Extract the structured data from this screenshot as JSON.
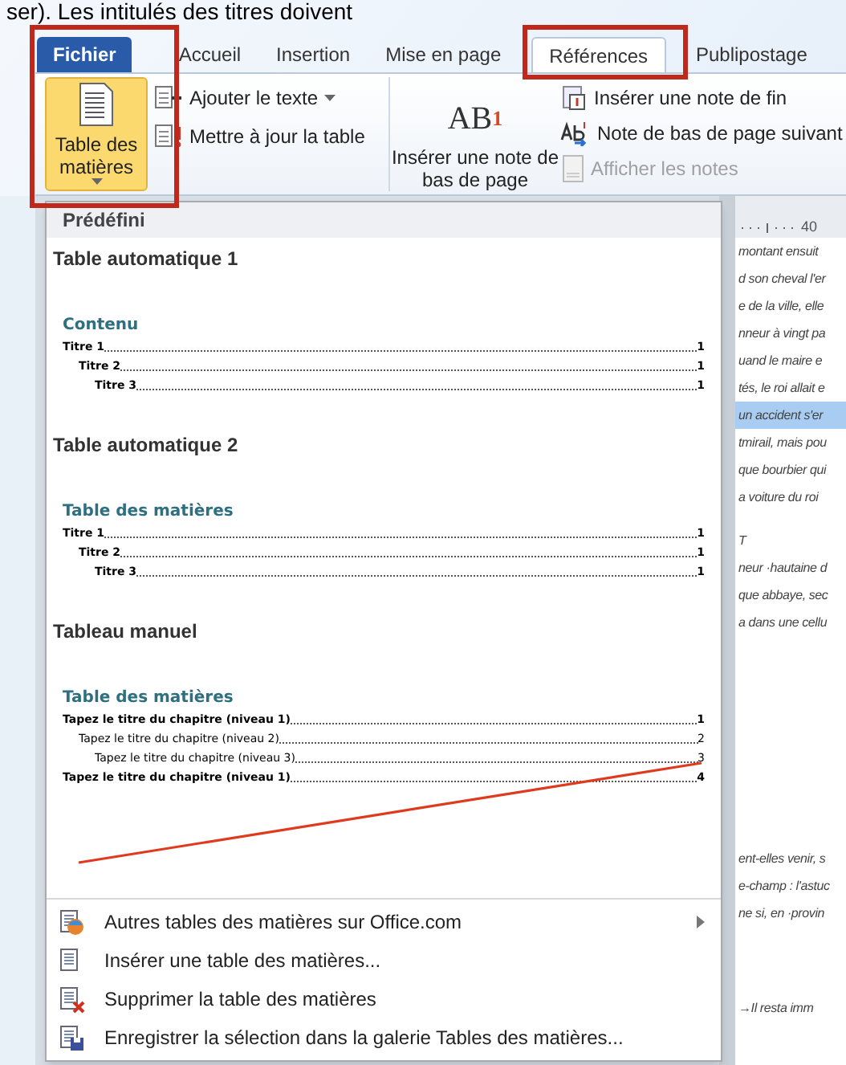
{
  "caption": "ser). Les intitulés des titres doivent",
  "tabs": [
    {
      "label": "Fichier",
      "kind": "file",
      "selected": false
    },
    {
      "label": "Accueil",
      "kind": "tab",
      "selected": false
    },
    {
      "label": "Insertion",
      "kind": "tab",
      "selected": false
    },
    {
      "label": "Mise en page",
      "kind": "tab",
      "selected": false
    },
    {
      "label": "Références",
      "kind": "tab",
      "selected": true
    },
    {
      "label": "Publipostage",
      "kind": "tab",
      "selected": false
    }
  ],
  "ribbon": {
    "toc_button": {
      "label": "Table des matières",
      "selected": true
    },
    "toc_items": [
      {
        "label": "Ajouter le texte",
        "kind": "add"
      },
      {
        "label": "Mettre à jour la table",
        "kind": "update"
      }
    ],
    "footnote_button": {
      "glyph": "AB",
      "mark": "1",
      "label": "Insérer une note de bas de page"
    },
    "footnote_items": [
      {
        "label": "Insérer une note de fin",
        "kind": "endnote",
        "disabled": false
      },
      {
        "label": "Note de bas de page suivant",
        "kind": "next",
        "disabled": false
      },
      {
        "label": "Afficher les notes",
        "kind": "show",
        "disabled": true
      }
    ]
  },
  "menu": {
    "header": "Prédéfini",
    "galleries": [
      {
        "title": "Table automatique 1",
        "kind": "automatic",
        "heading": "Contenu",
        "entries": [
          {
            "text": "Titre 1",
            "page": "1",
            "children": [
              {
                "text": "Titre 2",
                "page": "1",
                "children": [
                  {
                    "text": "Titre 3",
                    "page": "1"
                  }
                ]
              }
            ]
          }
        ]
      },
      {
        "title": "Table automatique 2",
        "kind": "automatic",
        "heading": "Table des matières",
        "entries": [
          {
            "text": "Titre 1",
            "page": "1",
            "children": [
              {
                "text": "Titre 2",
                "page": "1",
                "children": [
                  {
                    "text": "Titre 3",
                    "page": "1"
                  }
                ]
              }
            ]
          }
        ]
      },
      {
        "title": "Tableau manuel",
        "kind": "manual",
        "heading": "Table des matières",
        "entries": [
          {
            "text": "Tapez le titre du chapitre (niveau 1)",
            "page": "1",
            "children": [
              {
                "text": "Tapez le titre du chapitre (niveau 2)",
                "page": "2",
                "children": [
                  {
                    "text": "Tapez le titre du chapitre (niveau 3)",
                    "page": "3"
                  }
                ]
              }
            ]
          },
          {
            "text": "Tapez le titre du chapitre (niveau 1)",
            "page": "4"
          }
        ]
      }
    ],
    "actions": [
      {
        "label": "Autres tables des matières sur Office.com",
        "kind": "online",
        "submenu": true
      },
      {
        "label": "Insérer une table des matières...",
        "kind": "insert",
        "submenu": false
      },
      {
        "label": "Supprimer la table des matières",
        "kind": "delete",
        "submenu": false
      },
      {
        "label": "Enregistrer la sélection dans la galerie Tables des matières...",
        "kind": "save",
        "submenu": false
      }
    ]
  },
  "document": {
    "ruler": "40",
    "paragraphs": [
      [
        {
          "text": "montant ensuit",
          "highlighted": false
        },
        {
          "text": "d son cheval l'er",
          "highlighted": false
        },
        {
          "text": "e de la ville, elle",
          "highlighted": false
        },
        {
          "text": "nneur à vingt pa",
          "highlighted": false
        },
        {
          "text": "uand le maire e",
          "highlighted": false
        },
        {
          "text": "tés, le roi allait e",
          "highlighted": false
        },
        {
          "text": "un accident s'er",
          "highlighted": true
        },
        {
          "text": "tmirail, mais pou",
          "highlighted": false
        },
        {
          "text": "que bourbier qui",
          "highlighted": false
        },
        {
          "text": "a voiture du roi",
          "highlighted": false
        }
      ],
      [
        {
          "text": "T",
          "highlighted": false
        },
        {
          "text": "neur ·hautaine d",
          "highlighted": false
        },
        {
          "text": "que abbaye, sec",
          "highlighted": false
        },
        {
          "text": "a dans une cellu",
          "highlighted": false
        }
      ],
      [
        {
          "text": "ent-elles venir, s",
          "highlighted": false
        },
        {
          "text": "e-champ : l'astuc",
          "highlighted": false
        },
        {
          "text": "ne si, en ·provin",
          "highlighted": false
        }
      ],
      [
        {
          "text": "→Il resta imm",
          "highlighted": false
        }
      ]
    ]
  }
}
